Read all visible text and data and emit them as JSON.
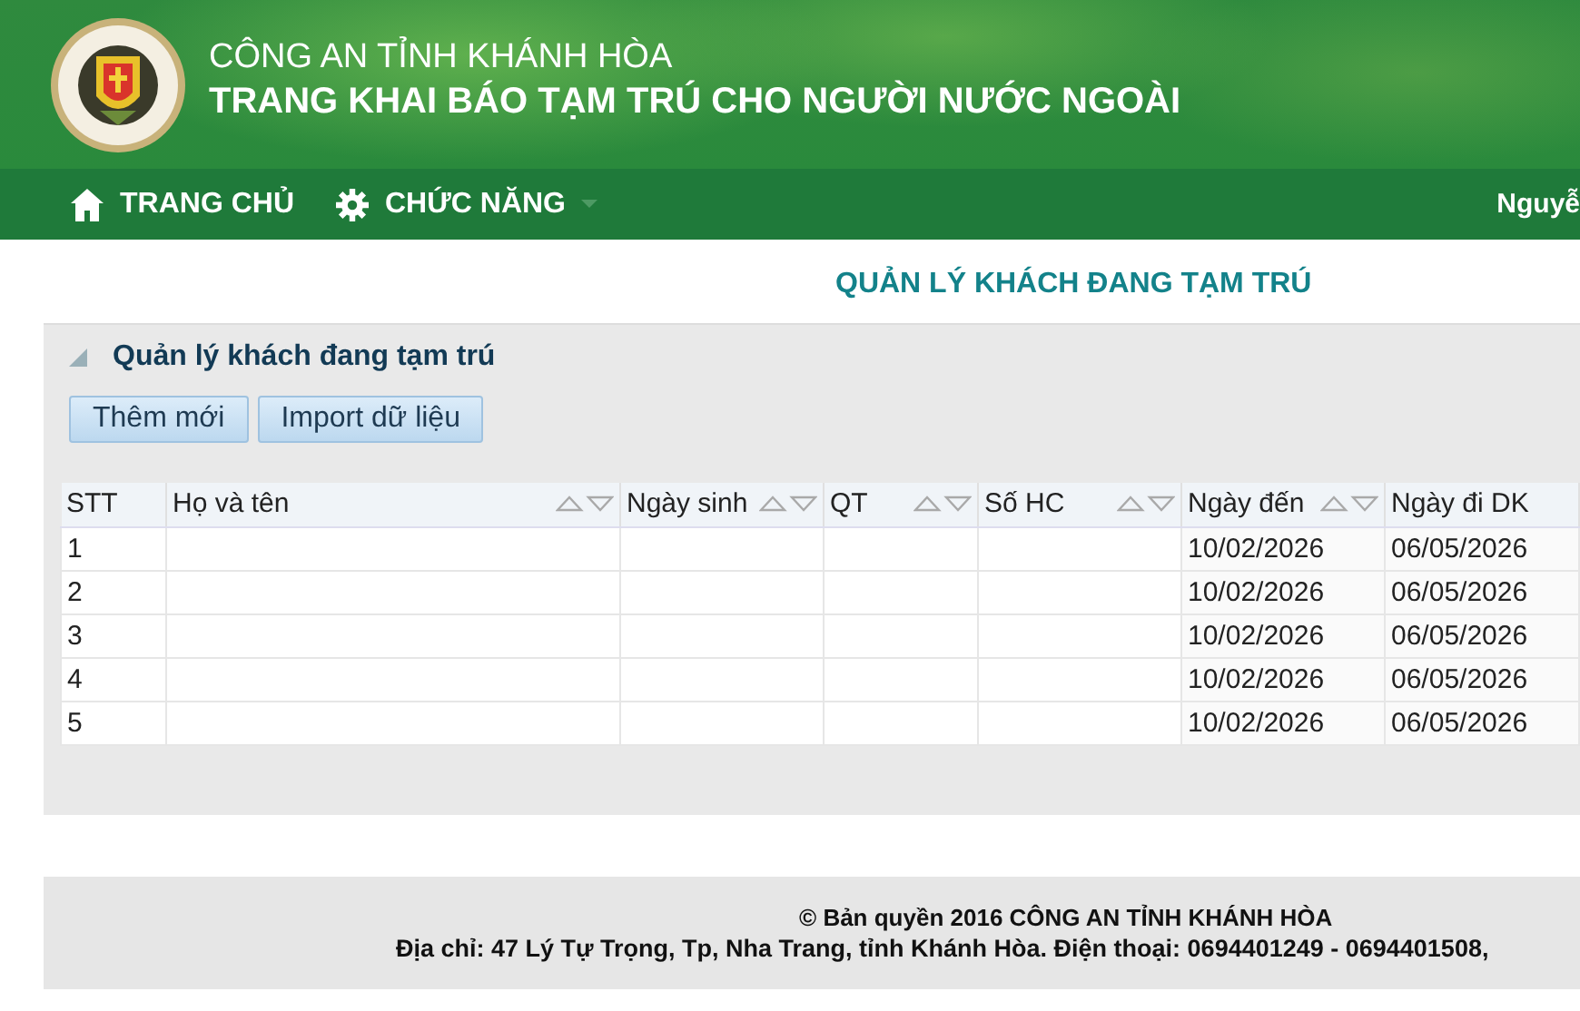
{
  "header": {
    "subtitle": "CÔNG AN TỈNH KHÁNH HÒA",
    "title": "TRANG KHAI BÁO TẠM TRÚ CHO NGƯỜI NƯỚC NGOÀI"
  },
  "nav": {
    "items": [
      {
        "label": "TRANG CHỦ",
        "dropdown": false
      },
      {
        "label": "CHỨC NĂNG",
        "dropdown": true
      }
    ],
    "user": "Nguyễ"
  },
  "page_title": "QUẢN LÝ KHÁCH ĐANG TẠM TRÚ",
  "panel": {
    "title": "Quản lý khách đang tạm trú",
    "buttons": [
      "Thêm mới",
      "Import dữ liệu"
    ],
    "table": {
      "columns": [
        {
          "label": "STT",
          "sortable": false
        },
        {
          "label": "Họ và tên",
          "sortable": true
        },
        {
          "label": "Ngày sinh",
          "sortable": true
        },
        {
          "label": "QT",
          "sortable": true
        },
        {
          "label": "Số HC",
          "sortable": true
        },
        {
          "label": "Ngày đến",
          "sortable": true
        },
        {
          "label": "Ngày đi DK",
          "sortable": false
        }
      ],
      "rows": [
        {
          "stt": "1",
          "ngay_den": "10/02/2026",
          "ngay_di_dk": "06/05/2026"
        },
        {
          "stt": "2",
          "ngay_den": "10/02/2026",
          "ngay_di_dk": "06/05/2026"
        },
        {
          "stt": "3",
          "ngay_den": "10/02/2026",
          "ngay_di_dk": "06/05/2026"
        },
        {
          "stt": "4",
          "ngay_den": "10/02/2026",
          "ngay_di_dk": "06/05/2026"
        },
        {
          "stt": "5",
          "ngay_den": "10/02/2026",
          "ngay_di_dk": "06/05/2026"
        }
      ]
    }
  },
  "footer": {
    "copyright": "© Bản quyền 2016 CÔNG AN TỈNH KHÁNH HÒA",
    "address": "Địa chỉ: 47 Lý Tự Trọng, Tp, Nha Trang, tỉnh Khánh Hòa. Điện thoại: 0694401249 - 0694401508,"
  }
}
